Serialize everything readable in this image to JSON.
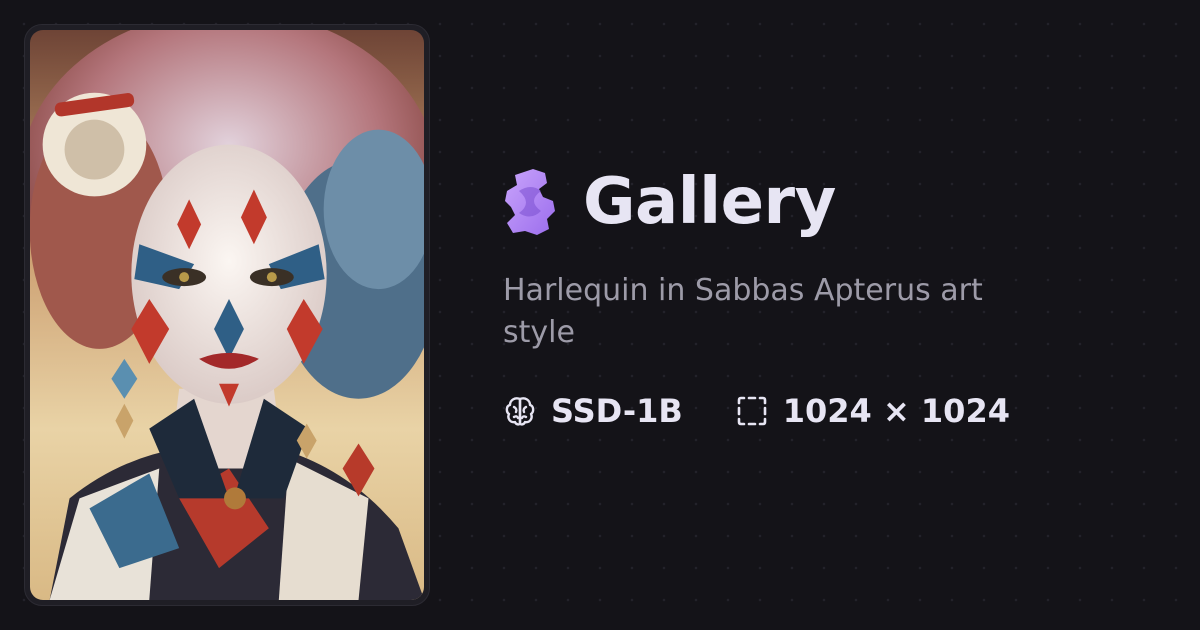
{
  "brand": {
    "title": "Gallery",
    "icon": "gear-s-logo-icon",
    "accent": "#b48af5"
  },
  "image": {
    "subject": "harlequin-portrait-artwork"
  },
  "prompt": "Harlequin in Sabbas Apterus art style",
  "meta": {
    "model_icon": "brain-icon",
    "model": "SSD-1B",
    "size_icon": "dashed-square-icon",
    "dimensions": "1024 × 1024"
  }
}
